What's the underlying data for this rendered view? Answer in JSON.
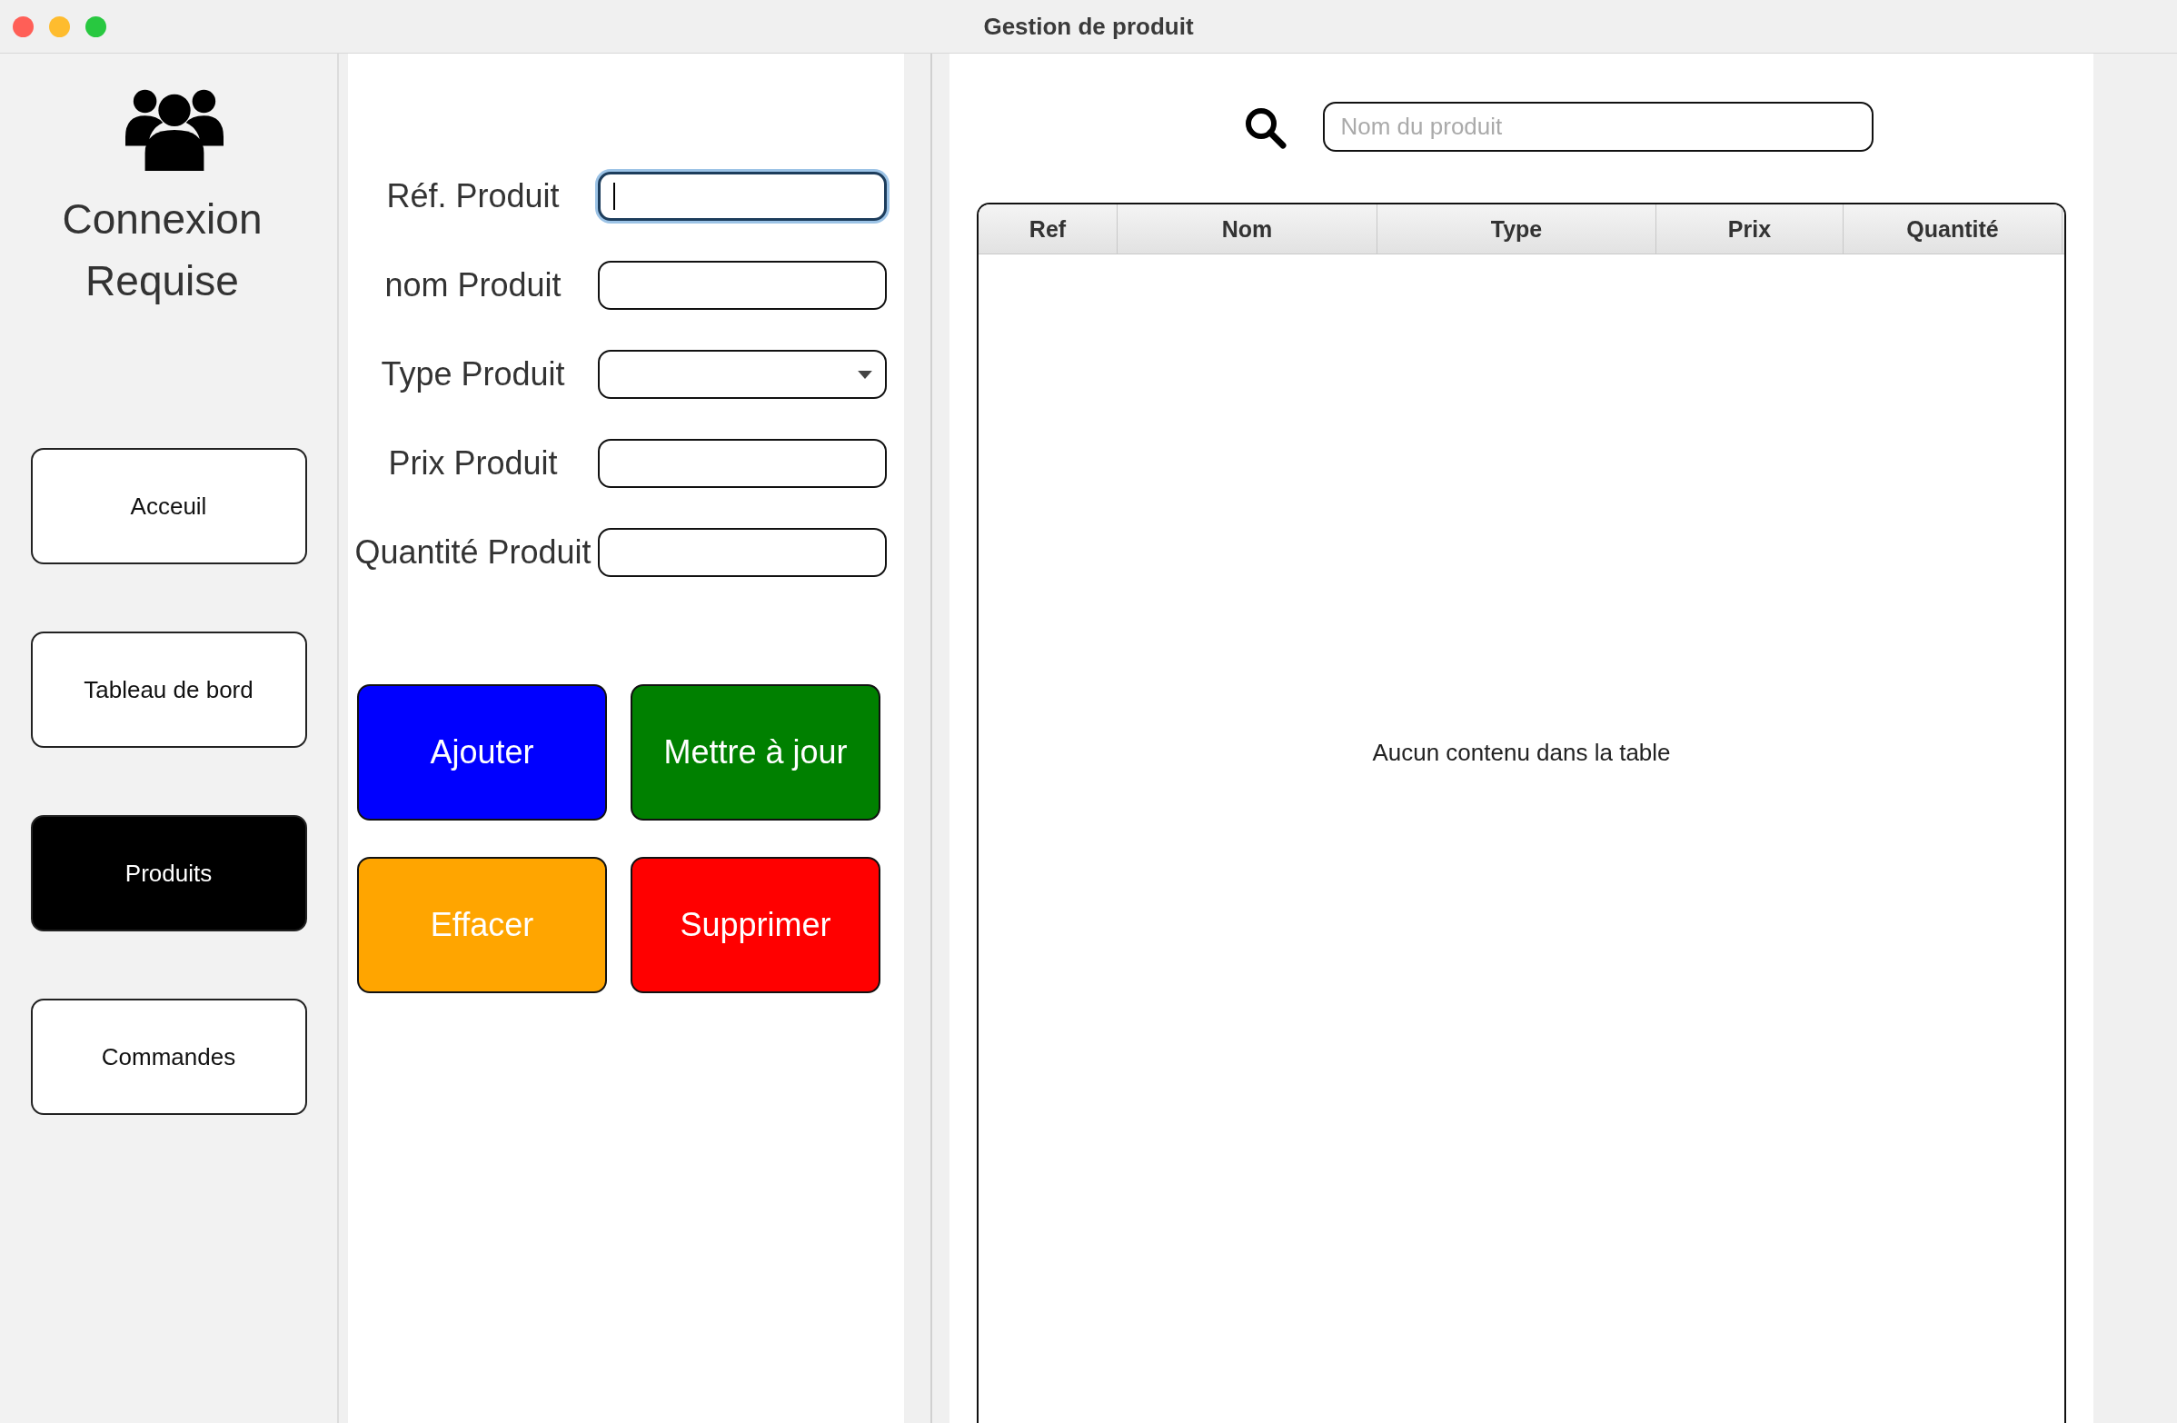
{
  "window": {
    "title": "Gestion de produit"
  },
  "sidebar": {
    "heading": "Connexion Requise",
    "nav": [
      {
        "label": "Acceuil",
        "selected": false
      },
      {
        "label": "Tableau de bord",
        "selected": false
      },
      {
        "label": "Produits",
        "selected": true
      },
      {
        "label": "Commandes",
        "selected": false
      }
    ]
  },
  "form": {
    "fields": [
      {
        "label": "Réf. Produit",
        "kind": "text",
        "focused": true
      },
      {
        "label": "nom Produit",
        "kind": "text",
        "focused": false
      },
      {
        "label": "Type Produit",
        "kind": "select",
        "focused": false
      },
      {
        "label": "Prix Produit",
        "kind": "text",
        "focused": false
      },
      {
        "label": "Quantité Produit",
        "kind": "text",
        "focused": false
      }
    ],
    "actions": [
      {
        "label": "Ajouter",
        "color": "#0000ff"
      },
      {
        "label": "Mettre à jour",
        "color": "#008000"
      },
      {
        "label": "Effacer",
        "color": "#ffa500"
      },
      {
        "label": "Supprimer",
        "color": "#ff0000"
      }
    ]
  },
  "search": {
    "placeholder": "Nom du produit"
  },
  "table": {
    "columns": [
      "Ref",
      "Nom",
      "Type",
      "Prix",
      "Quantité"
    ],
    "empty_message": "Aucun contenu dans la table"
  }
}
